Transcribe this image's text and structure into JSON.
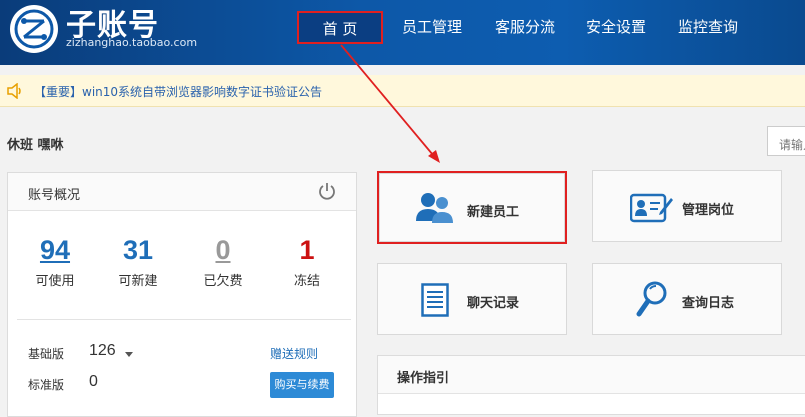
{
  "header": {
    "logo_title": "子账号",
    "logo_sub": "zizhanghao.taobao.com",
    "nav": [
      "首 页",
      "员工管理",
      "客服分流",
      "安全设置",
      "监控查询"
    ]
  },
  "notice": {
    "text": "【重要】win10系统自带浏览器影响数字证书验证公告"
  },
  "user": {
    "name": "休班 嘿咻"
  },
  "search": {
    "placeholder": "请输入"
  },
  "account": {
    "title": "账号概况",
    "stats": [
      {
        "num": "94",
        "label": "可使用"
      },
      {
        "num": "31",
        "label": "可新建"
      },
      {
        "num": "0",
        "label": "已欠费"
      },
      {
        "num": "1",
        "label": "冻结"
      }
    ],
    "basic_label": "基础版",
    "basic_value": "126",
    "standard_label": "标准版",
    "standard_value": "0",
    "gift_rule": "赠送规则",
    "buy_button": "购买与续费"
  },
  "actions": {
    "new_staff": "新建员工",
    "manage_post": "管理岗位",
    "chat_log": "聊天记录",
    "query_log": "查询日志"
  },
  "guide": {
    "title": "操作指引"
  },
  "colors": {
    "header_blue": "#0d58a8",
    "highlight_red": "#e02020",
    "link_blue": "#1f6eb8",
    "danger": "#cc1111"
  }
}
